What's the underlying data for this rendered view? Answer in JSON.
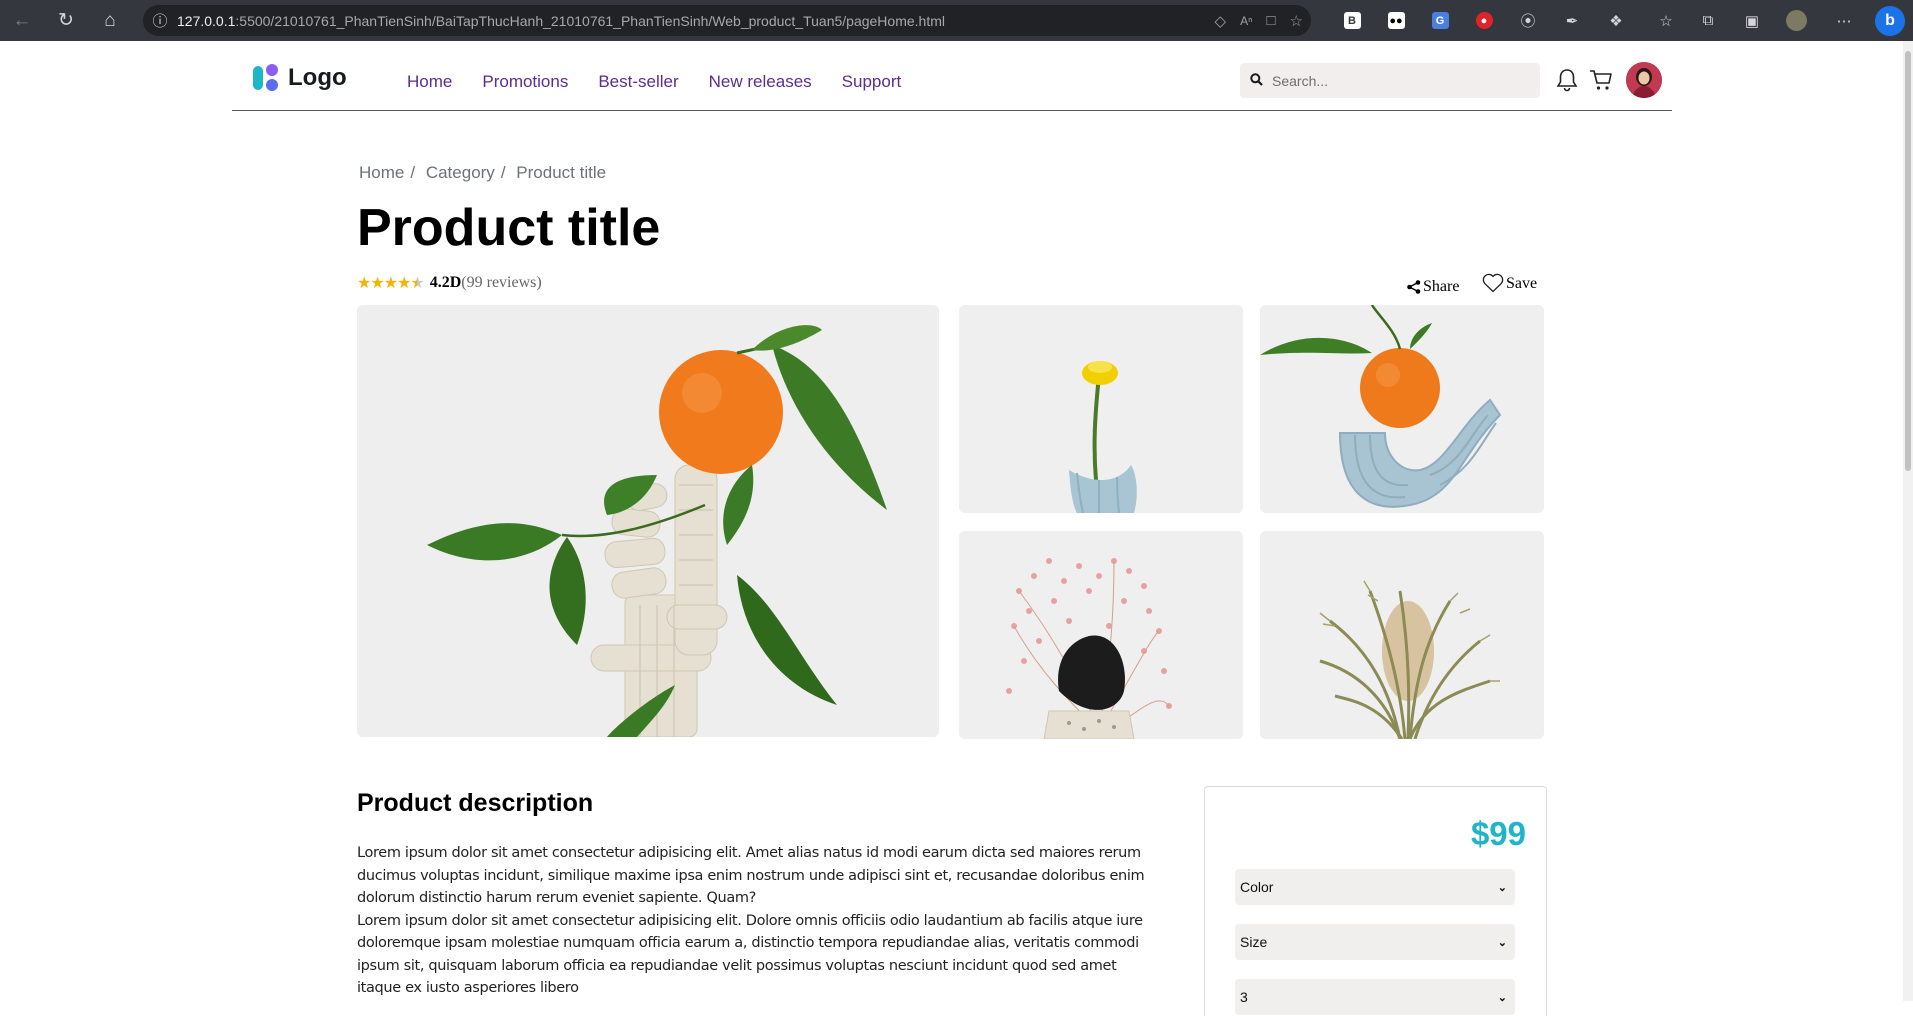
{
  "browser": {
    "url_host": "127.0.0.1",
    "url_rest": ":5500/21010761_PhanTienSinh/BaiTapThucHanh_21010761_PhanTienSinh/Web_product_Tuan5/pageHome.html"
  },
  "header": {
    "logo_text": "Logo",
    "nav": [
      "Home",
      "Promotions",
      "Best-seller",
      "New releases",
      "Support"
    ],
    "search_placeholder": "Search..."
  },
  "breadcrumb": [
    "Home",
    "Category",
    "Product title"
  ],
  "product": {
    "title": "Product title",
    "rating_value": 4.5,
    "rating_text": "4.2D",
    "reviews_text": "(99 reviews)",
    "share_label": "Share",
    "save_label": "Save"
  },
  "description": {
    "title": "Product description",
    "paragraph_1": "Lorem ipsum dolor sit amet consectetur adipisicing elit. Amet alias natus id modi earum dicta sed maiores rerum ducimus voluptas incidunt, similique maxime ipsa enim nostrum unde adipisci sint et, recusandae doloribus enim dolorum distinctio harum rerum eveniet sapiente. Quam?",
    "paragraph_2": "Lorem ipsum dolor sit amet consectetur adipisicing elit. Dolore omnis officiis odio laudantium ab facilis atque iure doloremque ipsam molestiae numquam officia earum a, distinctio tempora repudiandae alias, veritatis commodi ipsum sit, quisquam laborum officia ea repudiandae velit possimus voluptas nesciunt incidunt quod sed amet itaque ex iusto asperiores libero"
  },
  "buybox": {
    "price": "$99",
    "color_label": "Color",
    "size_label": "Size",
    "quantity_value": "3"
  },
  "colors": {
    "brand_purple": "#5c2d8f",
    "price_cyan": "#1fb5c9",
    "star": "#f4b400"
  }
}
